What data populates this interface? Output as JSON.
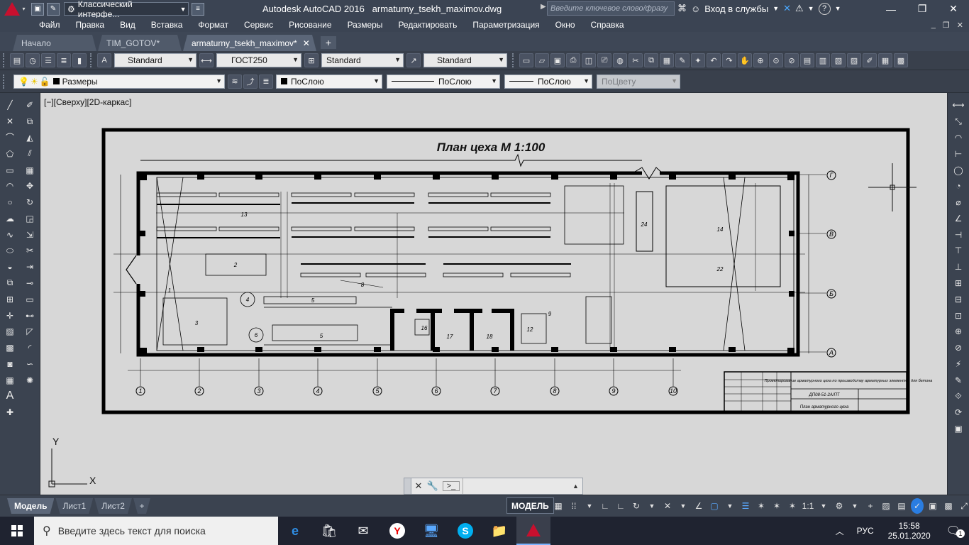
{
  "titlebar": {
    "workspace": "Классический интерфе...",
    "app_name": "Autodesk AutoCAD 2016",
    "file_name": "armaturny_tsekh_maximov.dwg",
    "search_placeholder": "Введите ключевое слово/фразу",
    "signin": "Вход в службы",
    "help": "?"
  },
  "menu": [
    "Файл",
    "Правка",
    "Вид",
    "Вставка",
    "Формат",
    "Сервис",
    "Рисование",
    "Размеры",
    "Редактировать",
    "Параметризация",
    "Окно",
    "Справка"
  ],
  "tabs": [
    {
      "label": "Начало",
      "active": false
    },
    {
      "label": "TIM_GOTOV*",
      "active": false
    },
    {
      "label": "armaturny_tsekh_maximov*",
      "active": true
    }
  ],
  "styles_toolbar": {
    "text_style": "Standard",
    "dim_style": "ГОСТ250",
    "table_style": "Standard",
    "mleader_style": "Standard"
  },
  "layers_toolbar": {
    "layer": "Размеры",
    "color": "ПоСлою",
    "linetype": "ПоСлою",
    "lineweight": "ПоСлою",
    "plotstyle": "ПоЦвету"
  },
  "viewport_label": "[−][Сверху][2D-каркас]",
  "drawing": {
    "title": "План цеха М 1:100",
    "axes_numbers": [
      "1",
      "2",
      "3",
      "4",
      "5",
      "6",
      "7",
      "8",
      "9",
      "10"
    ],
    "axes_letters": [
      "Г",
      "В",
      "Б",
      "А"
    ],
    "room_labels": [
      "24",
      "14",
      "2",
      "3",
      "1",
      "5",
      "5",
      "4",
      "6",
      "8",
      "17",
      "18",
      "16",
      "12",
      "9",
      "22",
      "13"
    ],
    "stamp": {
      "code": "ДП08-51-2А/ПТ",
      "sheet_title": "План арматурного цеха",
      "desc": "Проектирование арматурного цеха по производству арматурных элементов для бетона"
    }
  },
  "ucs": {
    "x": "X",
    "y": "Y"
  },
  "layout_tabs": [
    {
      "label": "Модель",
      "active": true
    },
    {
      "label": "Лист1",
      "active": false
    },
    {
      "label": "Лист2",
      "active": false
    }
  ],
  "status": {
    "space": "МОДЕЛЬ",
    "scale": "1:1"
  },
  "taskbar": {
    "search_placeholder": "Введите здесь текст для поиска",
    "lang": "РУС",
    "time": "15:58",
    "date": "25.01.2020",
    "notif_count": "1"
  },
  "colors": {
    "accent": "#c8102e",
    "canvas": "#d7d7d7",
    "ui_dark": "#3b4453"
  }
}
